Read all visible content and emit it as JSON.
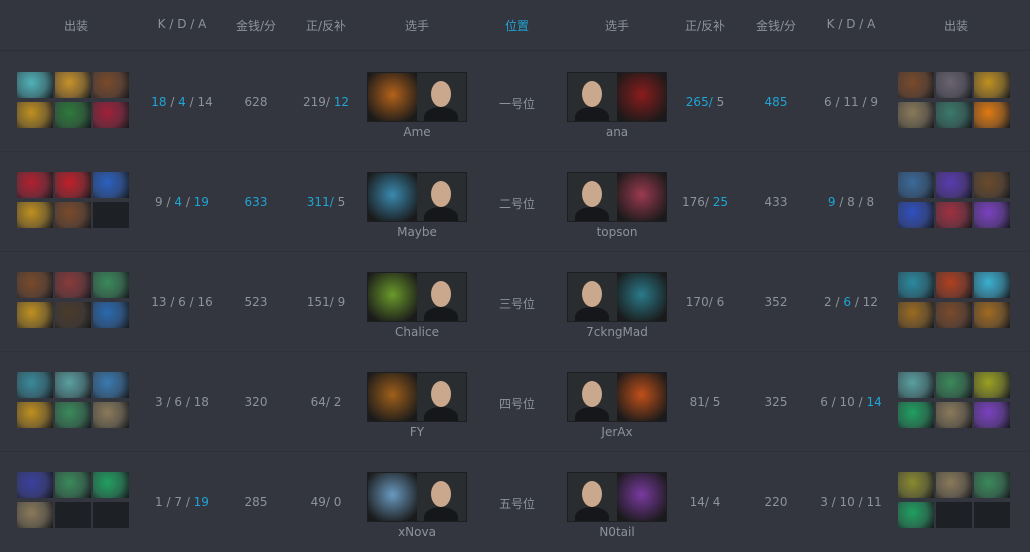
{
  "header": {
    "items_l": "出装",
    "kda_l": "K / D / A",
    "gpm_l": "金钱/分",
    "cs_l": "正/反补",
    "player_l": "选手",
    "position": "位置",
    "player_r": "选手",
    "cs_r": "正/反补",
    "gpm_r": "金钱/分",
    "kda_r": "K / D / A",
    "items_r": "出装"
  },
  "colors": {
    "highlight": "#1fa5d6",
    "text": "#8d939c",
    "background": "#33363e"
  },
  "rows": [
    {
      "position": "一号位",
      "left": {
        "player": "Ame",
        "hero_color": "#b4621a",
        "items": [
          "#4fb3b8",
          "#c8922a",
          "#7a4a2a",
          "#c09020",
          "#2d7a3a",
          "#a0203a"
        ],
        "kda": [
          {
            "v": "18",
            "hl": true
          },
          {
            "v": "4",
            "hl": true
          },
          {
            "v": "14",
            "hl": false
          }
        ],
        "gpm": {
          "v": "628",
          "hl": false
        },
        "cs": [
          {
            "v": "219",
            "hl": false
          },
          {
            "v": "12",
            "hl": true
          }
        ]
      },
      "right": {
        "player": "ana",
        "hero_color": "#8a1c1c",
        "items": [
          "#7a4a2a",
          "#6a6470",
          "#c09020",
          "#8a7a5a",
          "#3a7a6a",
          "#e07a10"
        ],
        "kda": [
          {
            "v": "6",
            "hl": false
          },
          {
            "v": "11",
            "hl": false
          },
          {
            "v": "9",
            "hl": false
          }
        ],
        "gpm": {
          "v": "485",
          "hl": true
        },
        "cs": [
          {
            "v": "265",
            "hl": true
          },
          {
            "v": "5",
            "hl": false
          }
        ]
      }
    },
    {
      "position": "二号位",
      "left": {
        "player": "Maybe",
        "hero_color": "#3a8ab0",
        "items": [
          "#b02030",
          "#c0202a",
          "#2a60c0",
          "#c09020",
          "#7a4a2a",
          null
        ],
        "kda": [
          {
            "v": "9",
            "hl": false
          },
          {
            "v": "4",
            "hl": true
          },
          {
            "v": "19",
            "hl": true
          }
        ],
        "gpm": {
          "v": "633",
          "hl": true
        },
        "cs": [
          {
            "v": "311",
            "hl": true
          },
          {
            "v": "5",
            "hl": false
          }
        ]
      },
      "right": {
        "player": "topson",
        "hero_color": "#9a3a50",
        "items": [
          "#3a6a9a",
          "#5a3ab0",
          "#6a4a2a",
          "#3050c0",
          "#a03040",
          "#7a40c0"
        ],
        "kda": [
          {
            "v": "9",
            "hl": true
          },
          {
            "v": "8",
            "hl": false
          },
          {
            "v": "8",
            "hl": false
          }
        ],
        "gpm": {
          "v": "433",
          "hl": false
        },
        "cs": [
          {
            "v": "176",
            "hl": false
          },
          {
            "v": "25",
            "hl": true
          }
        ]
      }
    },
    {
      "position": "三号位",
      "left": {
        "player": "Chalice",
        "hero_color": "#6a9a2a",
        "items": [
          "#7a4a2a",
          "#8a3a3a",
          "#3a8a5a",
          "#c09020",
          "#4a3a2a",
          "#2a6ab0"
        ],
        "kda": [
          {
            "v": "13",
            "hl": false
          },
          {
            "v": "6",
            "hl": false
          },
          {
            "v": "16",
            "hl": false
          }
        ],
        "gpm": {
          "v": "523",
          "hl": false
        },
        "cs": [
          {
            "v": "151",
            "hl": false
          },
          {
            "v": "9",
            "hl": false
          }
        ]
      },
      "right": {
        "player": "7ckngMad",
        "hero_color": "#2a7a8a",
        "items": [
          "#2a8aa0",
          "#b04020",
          "#3ab0d0",
          "#9a6a20",
          "#7a4a2a",
          "#a06a20"
        ],
        "kda": [
          {
            "v": "2",
            "hl": false
          },
          {
            "v": "6",
            "hl": true
          },
          {
            "v": "12",
            "hl": false
          }
        ],
        "gpm": {
          "v": "352",
          "hl": false
        },
        "cs": [
          {
            "v": "170",
            "hl": false
          },
          {
            "v": "6",
            "hl": false
          }
        ]
      }
    },
    {
      "position": "四号位",
      "left": {
        "player": "FY",
        "hero_color": "#a0601a",
        "items": [
          "#3a8a9a",
          "#5aa0a0",
          "#3a7ab0",
          "#c09020",
          "#3a8a5a",
          "#8a7a5a"
        ],
        "kda": [
          {
            "v": "3",
            "hl": false
          },
          {
            "v": "6",
            "hl": false
          },
          {
            "v": "18",
            "hl": false
          }
        ],
        "gpm": {
          "v": "320",
          "hl": false
        },
        "cs": [
          {
            "v": "64",
            "hl": false
          },
          {
            "v": "2",
            "hl": false
          }
        ]
      },
      "right": {
        "player": "JerAx",
        "hero_color": "#c0501a",
        "items": [
          "#5aa0a0",
          "#3a8a5a",
          "#9aa020",
          "#20a060",
          "#8a7a5a",
          "#7a40c0"
        ],
        "kda": [
          {
            "v": "6",
            "hl": false
          },
          {
            "v": "10",
            "hl": false
          },
          {
            "v": "14",
            "hl": true
          }
        ],
        "gpm": {
          "v": "325",
          "hl": false
        },
        "cs": [
          {
            "v": "81",
            "hl": false
          },
          {
            "v": "5",
            "hl": false
          }
        ]
      }
    },
    {
      "position": "五号位",
      "left": {
        "player": "xNova",
        "hero_color": "#6a9ac0",
        "items": [
          "#3a40a0",
          "#3a8a5a",
          "#20a060",
          "#8a7a5a",
          null,
          null
        ],
        "kda": [
          {
            "v": "1",
            "hl": false
          },
          {
            "v": "7",
            "hl": false
          },
          {
            "v": "19",
            "hl": true
          }
        ],
        "gpm": {
          "v": "285",
          "hl": false
        },
        "cs": [
          {
            "v": "49",
            "hl": false
          },
          {
            "v": "0",
            "hl": false
          }
        ]
      },
      "right": {
        "player": "N0tail",
        "hero_color": "#7a3aa0",
        "items": [
          "#8a8a30",
          "#8a7a5a",
          "#3a8a5a",
          "#20a060",
          null,
          null
        ],
        "kda": [
          {
            "v": "3",
            "hl": false
          },
          {
            "v": "10",
            "hl": false
          },
          {
            "v": "11",
            "hl": false
          }
        ],
        "gpm": {
          "v": "220",
          "hl": false
        },
        "cs": [
          {
            "v": "14",
            "hl": false
          },
          {
            "v": "4",
            "hl": false
          }
        ]
      }
    }
  ]
}
